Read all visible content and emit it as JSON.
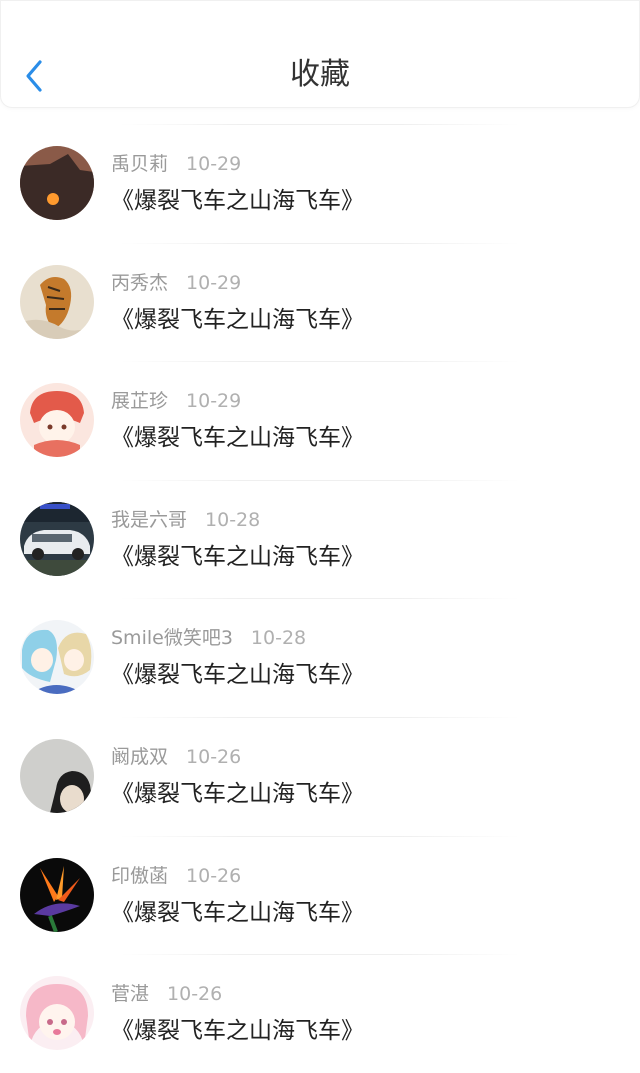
{
  "header": {
    "title": "收藏"
  },
  "items": [
    {
      "name": "禹贝莉",
      "date": "10-29",
      "work": "《爆裂飞车之山海飞车》",
      "avatar": "sunset-avatar"
    },
    {
      "name": "丙秀杰",
      "date": "10-29",
      "work": "《爆裂飞车之山海飞车》",
      "avatar": "tiger-avatar"
    },
    {
      "name": "展芷珍",
      "date": "10-29",
      "work": "《爆裂飞车之山海飞车》",
      "avatar": "anime-girl-avatar"
    },
    {
      "name": "我是六哥",
      "date": "10-28",
      "work": "《爆裂飞车之山海飞车》",
      "avatar": "car-avatar"
    },
    {
      "name": "Smile微笑吧3",
      "date": "10-28",
      "work": "《爆裂飞车之山海飞车》",
      "avatar": "anime-duo-avatar"
    },
    {
      "name": "阚成双",
      "date": "10-26",
      "work": "《爆裂飞车之山海飞车》",
      "avatar": "person-avatar"
    },
    {
      "name": "印傲菡",
      "date": "10-26",
      "work": "《爆裂飞车之山海飞车》",
      "avatar": "bird-of-paradise-avatar"
    },
    {
      "name": "菅湛",
      "date": "10-26",
      "work": "《爆裂飞车之山海飞车》",
      "avatar": "pink-anime-avatar"
    }
  ],
  "colors": {
    "accent": "#2a8de8",
    "title": "#333333",
    "meta": "#9a9a9a"
  }
}
